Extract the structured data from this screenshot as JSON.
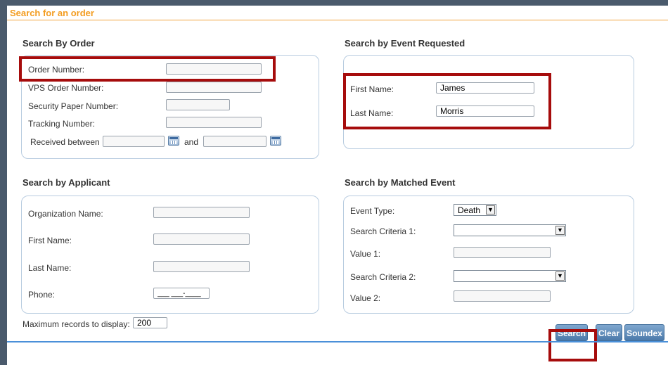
{
  "page": {
    "title": "Search for an order"
  },
  "search_by_order": {
    "title": "Search By Order",
    "order_number_label": "Order Number:",
    "vps_order_number_label": "VPS Order Number:",
    "security_paper_number_label": "Security Paper Number:",
    "tracking_number_label": "Tracking Number:",
    "received_between_label": "Received between",
    "and_label": "and"
  },
  "search_by_event_requested": {
    "title": "Search by Event Requested",
    "first_name_label": "First Name:",
    "first_name_value": "James",
    "last_name_label": "Last Name:",
    "last_name_value": "Morris"
  },
  "search_by_applicant": {
    "title": "Search by Applicant",
    "organization_name_label": "Organization Name:",
    "first_name_label": "First Name:",
    "last_name_label": "Last Name:",
    "phone_label": "Phone:",
    "phone_mask": "___ ___-____"
  },
  "search_by_matched_event": {
    "title": "Search by Matched Event",
    "event_type_label": "Event Type:",
    "event_type_value": "Death",
    "search_criteria_1_label": "Search Criteria 1:",
    "value_1_label": "Value 1:",
    "search_criteria_2_label": "Search Criteria 2:",
    "value_2_label": "Value 2:"
  },
  "max_records": {
    "label": "Maximum records to display:",
    "value": "200"
  },
  "buttons": {
    "search": "Search",
    "clear": "Clear",
    "soundex": "Soundex"
  },
  "colors": {
    "title_orange": "#f39c1f",
    "highlight_red": "#a60c0c",
    "button_blue": "#5b87b5",
    "panel_border": "#b8cce0"
  },
  "icons": {
    "calendar": "calendar-icon",
    "dropdown": "chevron-down-icon"
  }
}
